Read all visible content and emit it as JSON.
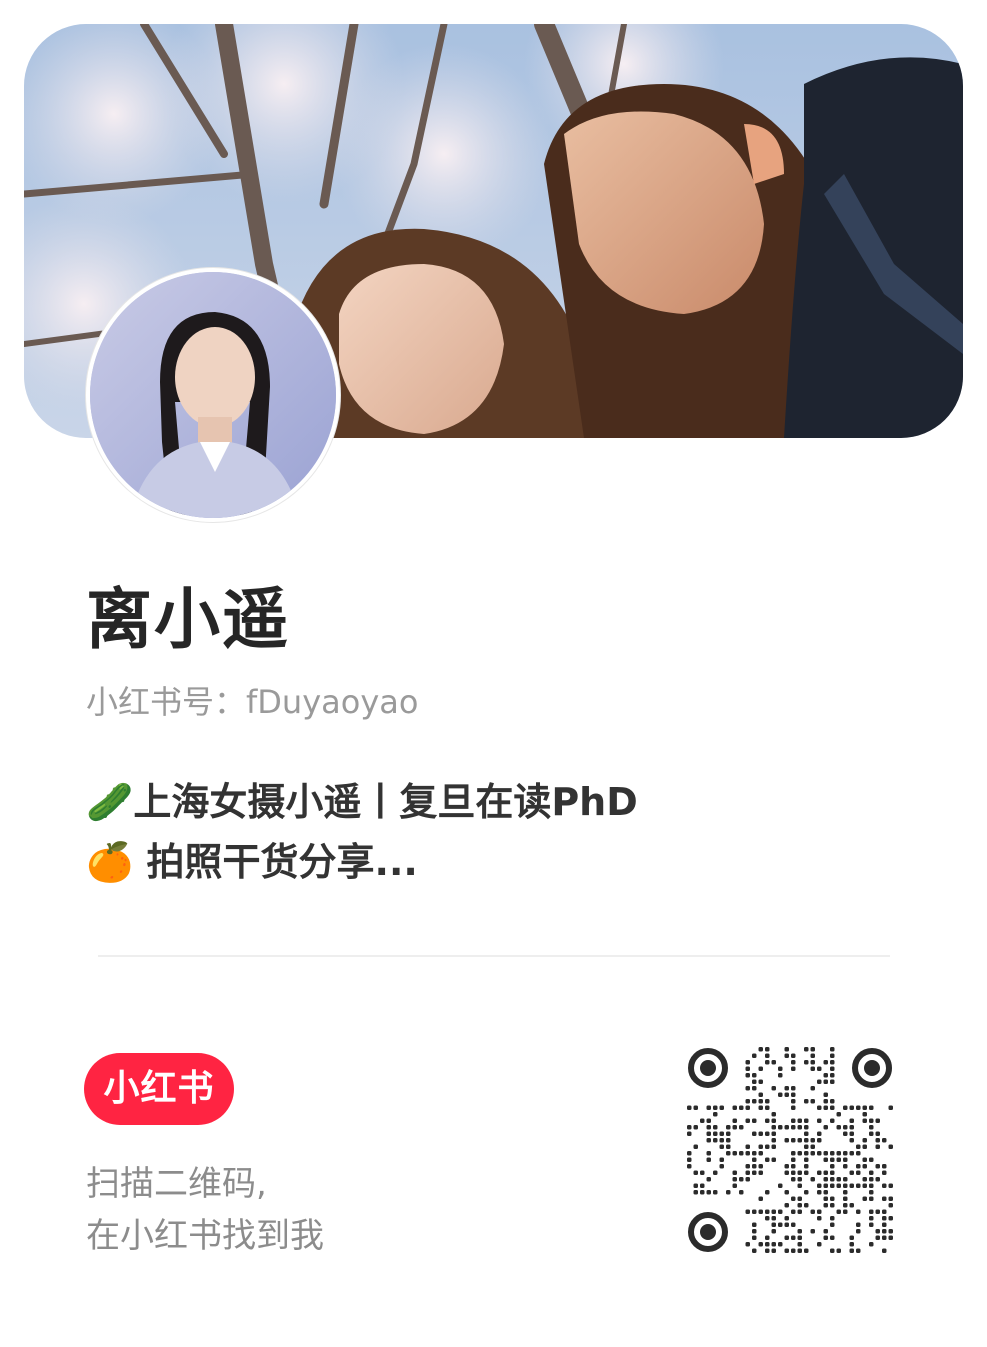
{
  "profile": {
    "name": "离小遥",
    "id_label": "小红书号：",
    "id_value": "fDuyaoyao",
    "bio": [
      {
        "emoji": "🥒",
        "text": "上海女摄小遥丨复旦在读PhD"
      },
      {
        "emoji": "🍊",
        "text": " 拍照干货分享..."
      }
    ]
  },
  "footer": {
    "logo_text": "小红书",
    "scan_line1": "扫描二维码,",
    "scan_line2": "在小红书找到我"
  },
  "colors": {
    "brand": "#ff2442",
    "name_text": "#262626",
    "muted_text": "#9a9a9a",
    "divider": "#eeeeee"
  },
  "icons": {
    "banner": "cover-photo",
    "avatar": "avatar-photo",
    "qr": "qr-code"
  }
}
